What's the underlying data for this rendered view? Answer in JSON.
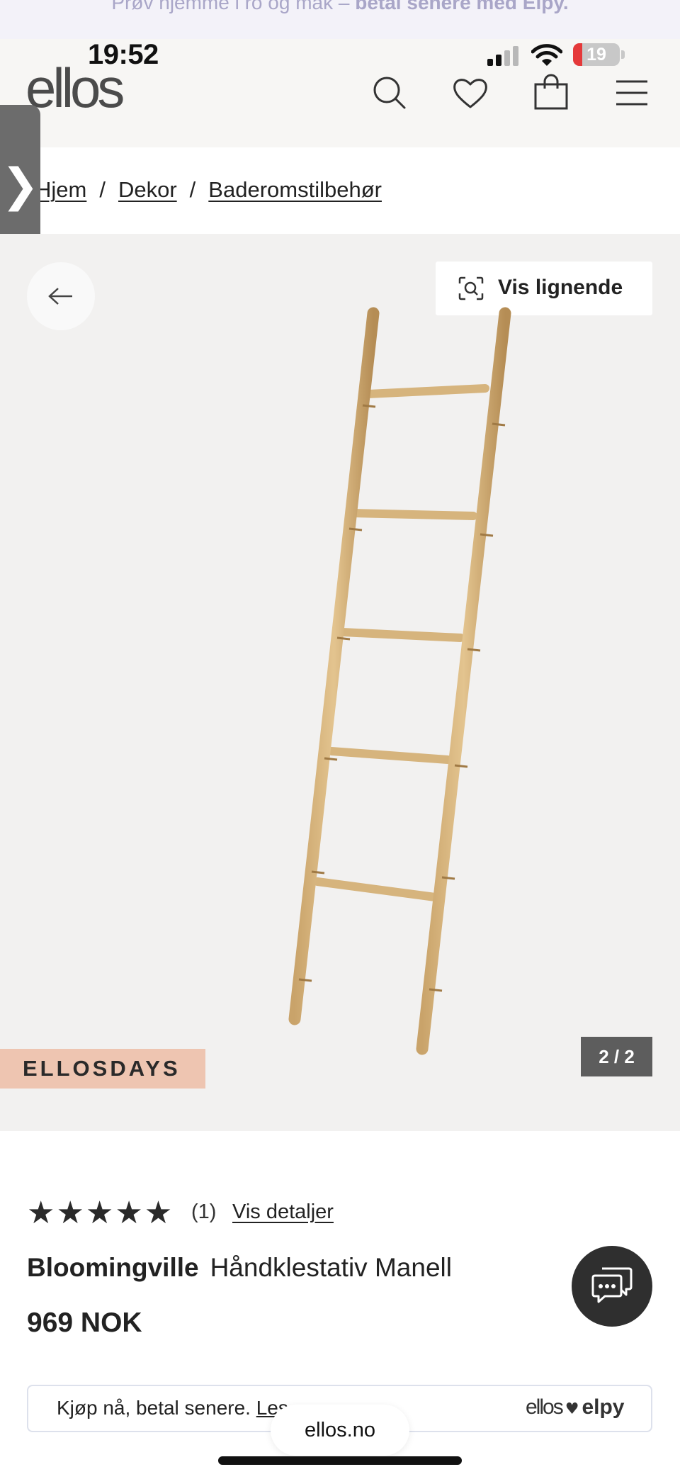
{
  "promo": {
    "text_start": "Prøv hjemme i ro og mak – ",
    "text_bold": "betal senere med Elpy."
  },
  "status_bar": {
    "time": "19:52",
    "battery": "19",
    "battery_level": 0.19,
    "battery_color": "#e5393a"
  },
  "header": {
    "logo": "ellos",
    "icons": [
      "search-icon",
      "heart-icon",
      "shopping-bag-icon",
      "menu-icon"
    ]
  },
  "side_tab": {
    "glyph": "❯"
  },
  "breadcrumb": [
    {
      "label": "Hjem"
    },
    {
      "label": "Dekor"
    },
    {
      "label": "Baderomstilbehør"
    }
  ],
  "gallery": {
    "back_icon": "arrow-left-icon",
    "similar_label": "Vis lignende",
    "similar_icon": "visual-search-icon",
    "badge": "ELLOSDAYS",
    "badge_color": "#eec5b1",
    "counter": "2 / 2"
  },
  "product": {
    "stars": "★★★★★",
    "rating_value": 5,
    "rating_count": "(1)",
    "details_link": "Vis detaljer",
    "brand": "Bloomingville",
    "name": "Håndklestativ Manell",
    "price": "969 NOK"
  },
  "chat": {
    "icon": "chat-icon"
  },
  "pay_banner": {
    "text": "Kjøp nå, betal senere. ",
    "link": "Les",
    "logo_left": "ellos",
    "logo_heart": "♥",
    "logo_right": "elpy"
  },
  "browser": {
    "url": "ellos.no"
  }
}
